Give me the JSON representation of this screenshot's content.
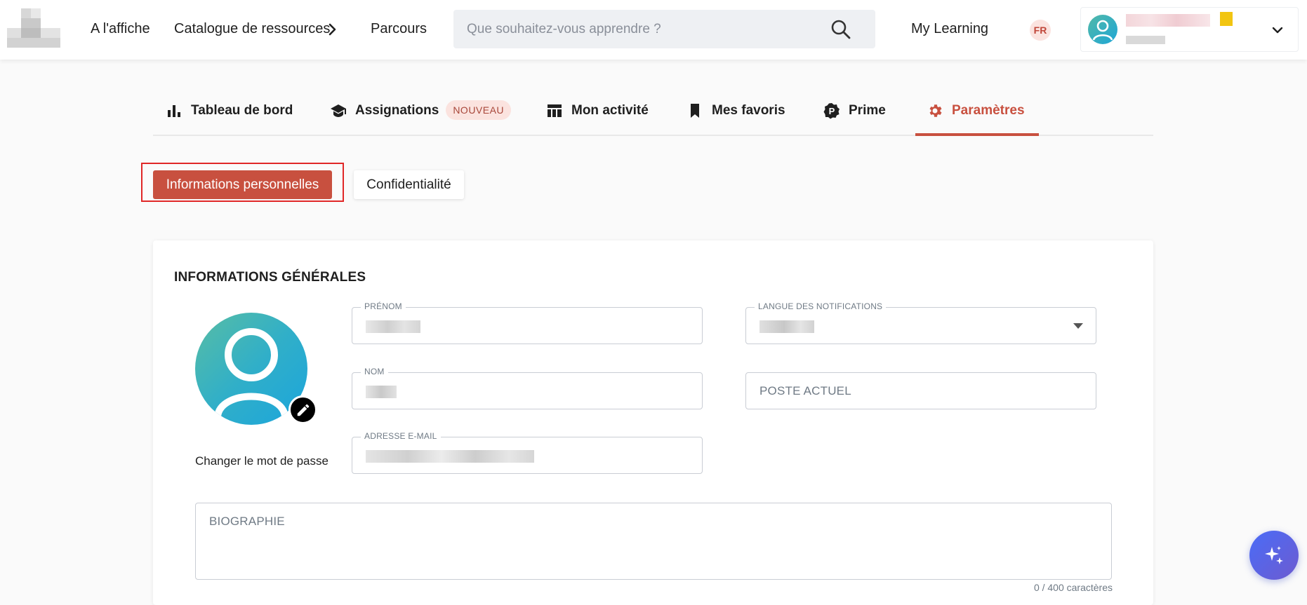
{
  "header": {
    "nav": [
      {
        "label": "A l'affiche"
      },
      {
        "label": "Catalogue de ressources"
      },
      {
        "label": "Parcours"
      }
    ],
    "search_placeholder": "Que souhaitez-vous apprendre ?",
    "my_learning": "My Learning",
    "language": "FR",
    "icons": {
      "search": "search-icon",
      "catalog_chevron": "chevron-right-icon",
      "user": "user-avatar-icon",
      "user_menu": "chevron-down-icon"
    }
  },
  "tabs": [
    {
      "label": "Tableau de bord",
      "icon": "bar-chart-icon"
    },
    {
      "label": "Assignations",
      "icon": "graduation-cap-icon",
      "badge": "NOUVEAU"
    },
    {
      "label": "Mon activité",
      "icon": "table-icon"
    },
    {
      "label": "Mes favoris",
      "icon": "bookmark-icon"
    },
    {
      "label": "Prime",
      "icon": "prime-icon"
    },
    {
      "label": "Paramètres",
      "icon": "gear-icon",
      "active": true
    }
  ],
  "subtabs": {
    "personal_info": "Informations personnelles",
    "privacy": "Confidentialité"
  },
  "card": {
    "title": "INFORMATIONS GÉNÉRALES",
    "change_password": "Changer le mot de passe",
    "fields": {
      "prenom": {
        "label": "PRÉNOM"
      },
      "nom": {
        "label": "NOM"
      },
      "email": {
        "label": "ADRESSE E-MAIL"
      },
      "langue": {
        "label": "LANGUE DES NOTIFICATIONS"
      },
      "poste": {
        "placeholder": "POSTE ACTUEL"
      },
      "biographie": {
        "placeholder": "BIOGRAPHIE"
      }
    },
    "counter": "0 / 400 caractères"
  },
  "colors": {
    "accent": "#c8503f",
    "highlight_frame": "#e02727",
    "badge_bg": "#fbe3df",
    "fab": "#4a6cf7"
  }
}
